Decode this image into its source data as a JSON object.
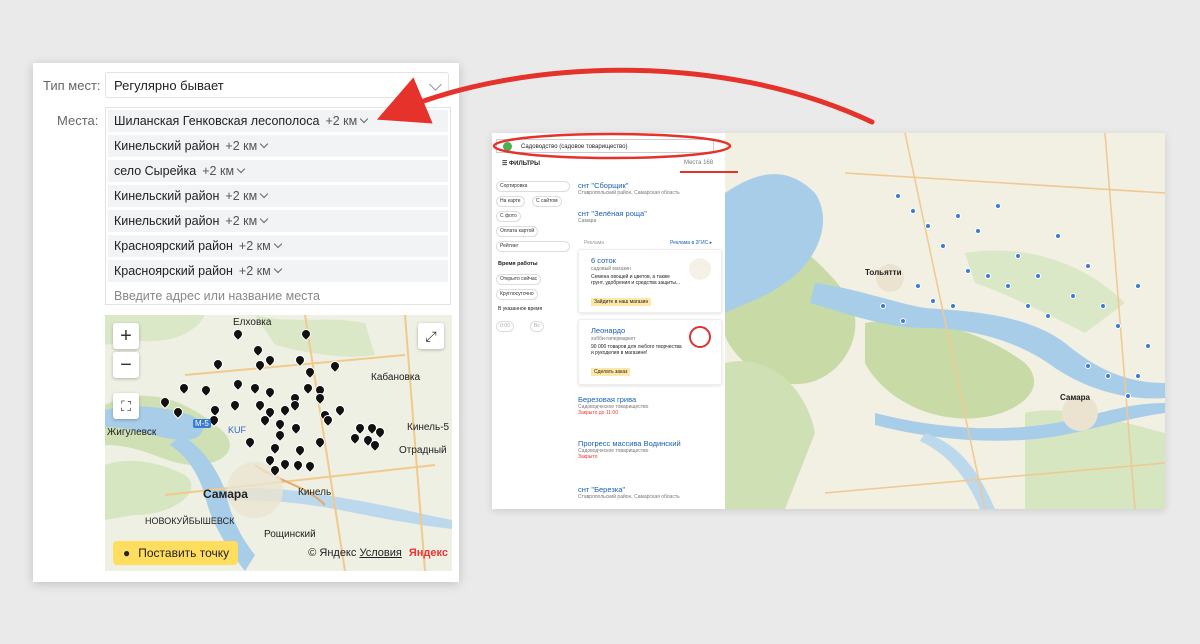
{
  "form": {
    "type_label": "Тип мест:",
    "type_value": "Регулярно бывает",
    "places_label": "Места:",
    "places": [
      {
        "name": "Шиланская Генковская лесополоса",
        "dist": "+2 км"
      },
      {
        "name": "Кинельский район",
        "dist": "+2 км"
      },
      {
        "name": "село Сырейка",
        "dist": "+2 км"
      },
      {
        "name": "Кинельский район",
        "dist": "+2 км"
      },
      {
        "name": "Кинельский район",
        "dist": "+2 км"
      },
      {
        "name": "Красноярский район",
        "dist": "+2 км"
      },
      {
        "name": "Красноярский район",
        "dist": "+2 км"
      }
    ],
    "address_placeholder": "Введите адрес или название места"
  },
  "small_map": {
    "zoom_in": "+",
    "zoom_out": "−",
    "labels": {
      "elkhovka": "Елховка",
      "kabanovka": "Кабановка",
      "zhigulevsk": "Жигулевск",
      "kinel5": "Кинель-5",
      "otradny": "Отрадный",
      "samara": "Самара",
      "kinel": "Кинель",
      "novokuib": "НОВОКУЙБЫШЕВСК",
      "roshchinsky": "Рощинский",
      "kuf": "KUF",
      "m5": "М-5"
    },
    "place_button": "Поставить точку",
    "copyright": "© Яндекс",
    "terms": "Условия",
    "brand": "Яндекс"
  },
  "yandex": {
    "search": "Садоводство (садовое товарищество)",
    "filters": "ФИЛЬТРЫ",
    "places_count_label": "Места",
    "places_count": "168",
    "sort": "Сортировка",
    "on_map": "На карте",
    "with_site": "С сайтом",
    "with_photo": "С фото",
    "card_payment": "Оплата картой",
    "price": "Рейтинг",
    "hours_title": "Время работы",
    "open_now": "Открыто сейчас",
    "round_clock": "Круглосуточно",
    "at_time": "В указанное время",
    "t1": "0:00",
    "t2": "Вс",
    "results": [
      {
        "title": "снт \"Сборщик\"",
        "sub": "Ставропольский район, Самарская область"
      },
      {
        "title": "снт \"Зелёная роща\"",
        "sub": "Самара"
      }
    ],
    "ads_label": "Реклама",
    "ads_link": "Реклама в 2ГИС ▸",
    "ads": [
      {
        "title": "6 соток",
        "sub": "садовый магазин",
        "desc": "Семена овощей и цветов, а также грунт, удобрения и средства защиты...",
        "btn": "Зайдите в наш магазин"
      },
      {
        "title": "Леонардо",
        "sub": "хобби-гипермаркет",
        "desc": "90 000 товаров для любого творчества и рукоделия в магазине!",
        "btn": "Сделать заказ"
      }
    ],
    "results2": [
      {
        "title": "Березовая грива",
        "sub": "Садоводческое товарищество",
        "extra": "Закрыто до 11:00"
      },
      {
        "title": "Прогресс массива Водинский",
        "sub": "Садоводческое товарищество",
        "extra": "Закрыто"
      },
      {
        "title": "снт \"Березка\"",
        "sub": "Ставропольский район, Самарская область",
        "extra": ""
      }
    ],
    "city1": "Тольятти",
    "city2": "Самара"
  },
  "colors": {
    "arrow": "#e5322b",
    "water": "#a8cde8",
    "forest": "#c8dba6",
    "land": "#f2efe3"
  }
}
